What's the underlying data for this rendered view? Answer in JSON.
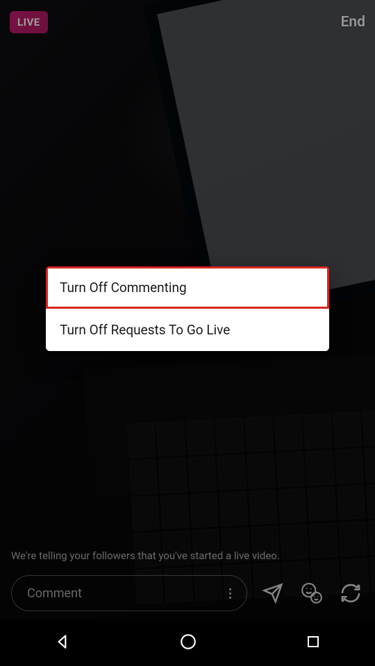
{
  "top": {
    "live_badge": "LIVE",
    "end_label": "End"
  },
  "sheet": {
    "items": [
      {
        "label": "Turn Off Commenting",
        "highlighted": true
      },
      {
        "label": "Turn Off Requests To Go Live",
        "highlighted": false
      }
    ]
  },
  "status": {
    "text": "We're telling your followers that you've started a live video."
  },
  "composer": {
    "placeholder": "Comment"
  },
  "icons": {
    "more": "more-icon",
    "send": "send-icon",
    "reactions": "face-reaction-icon",
    "switch_camera": "switch-camera-icon"
  },
  "nav": {
    "back": "back-icon",
    "home": "home-icon",
    "recents": "recents-icon"
  }
}
